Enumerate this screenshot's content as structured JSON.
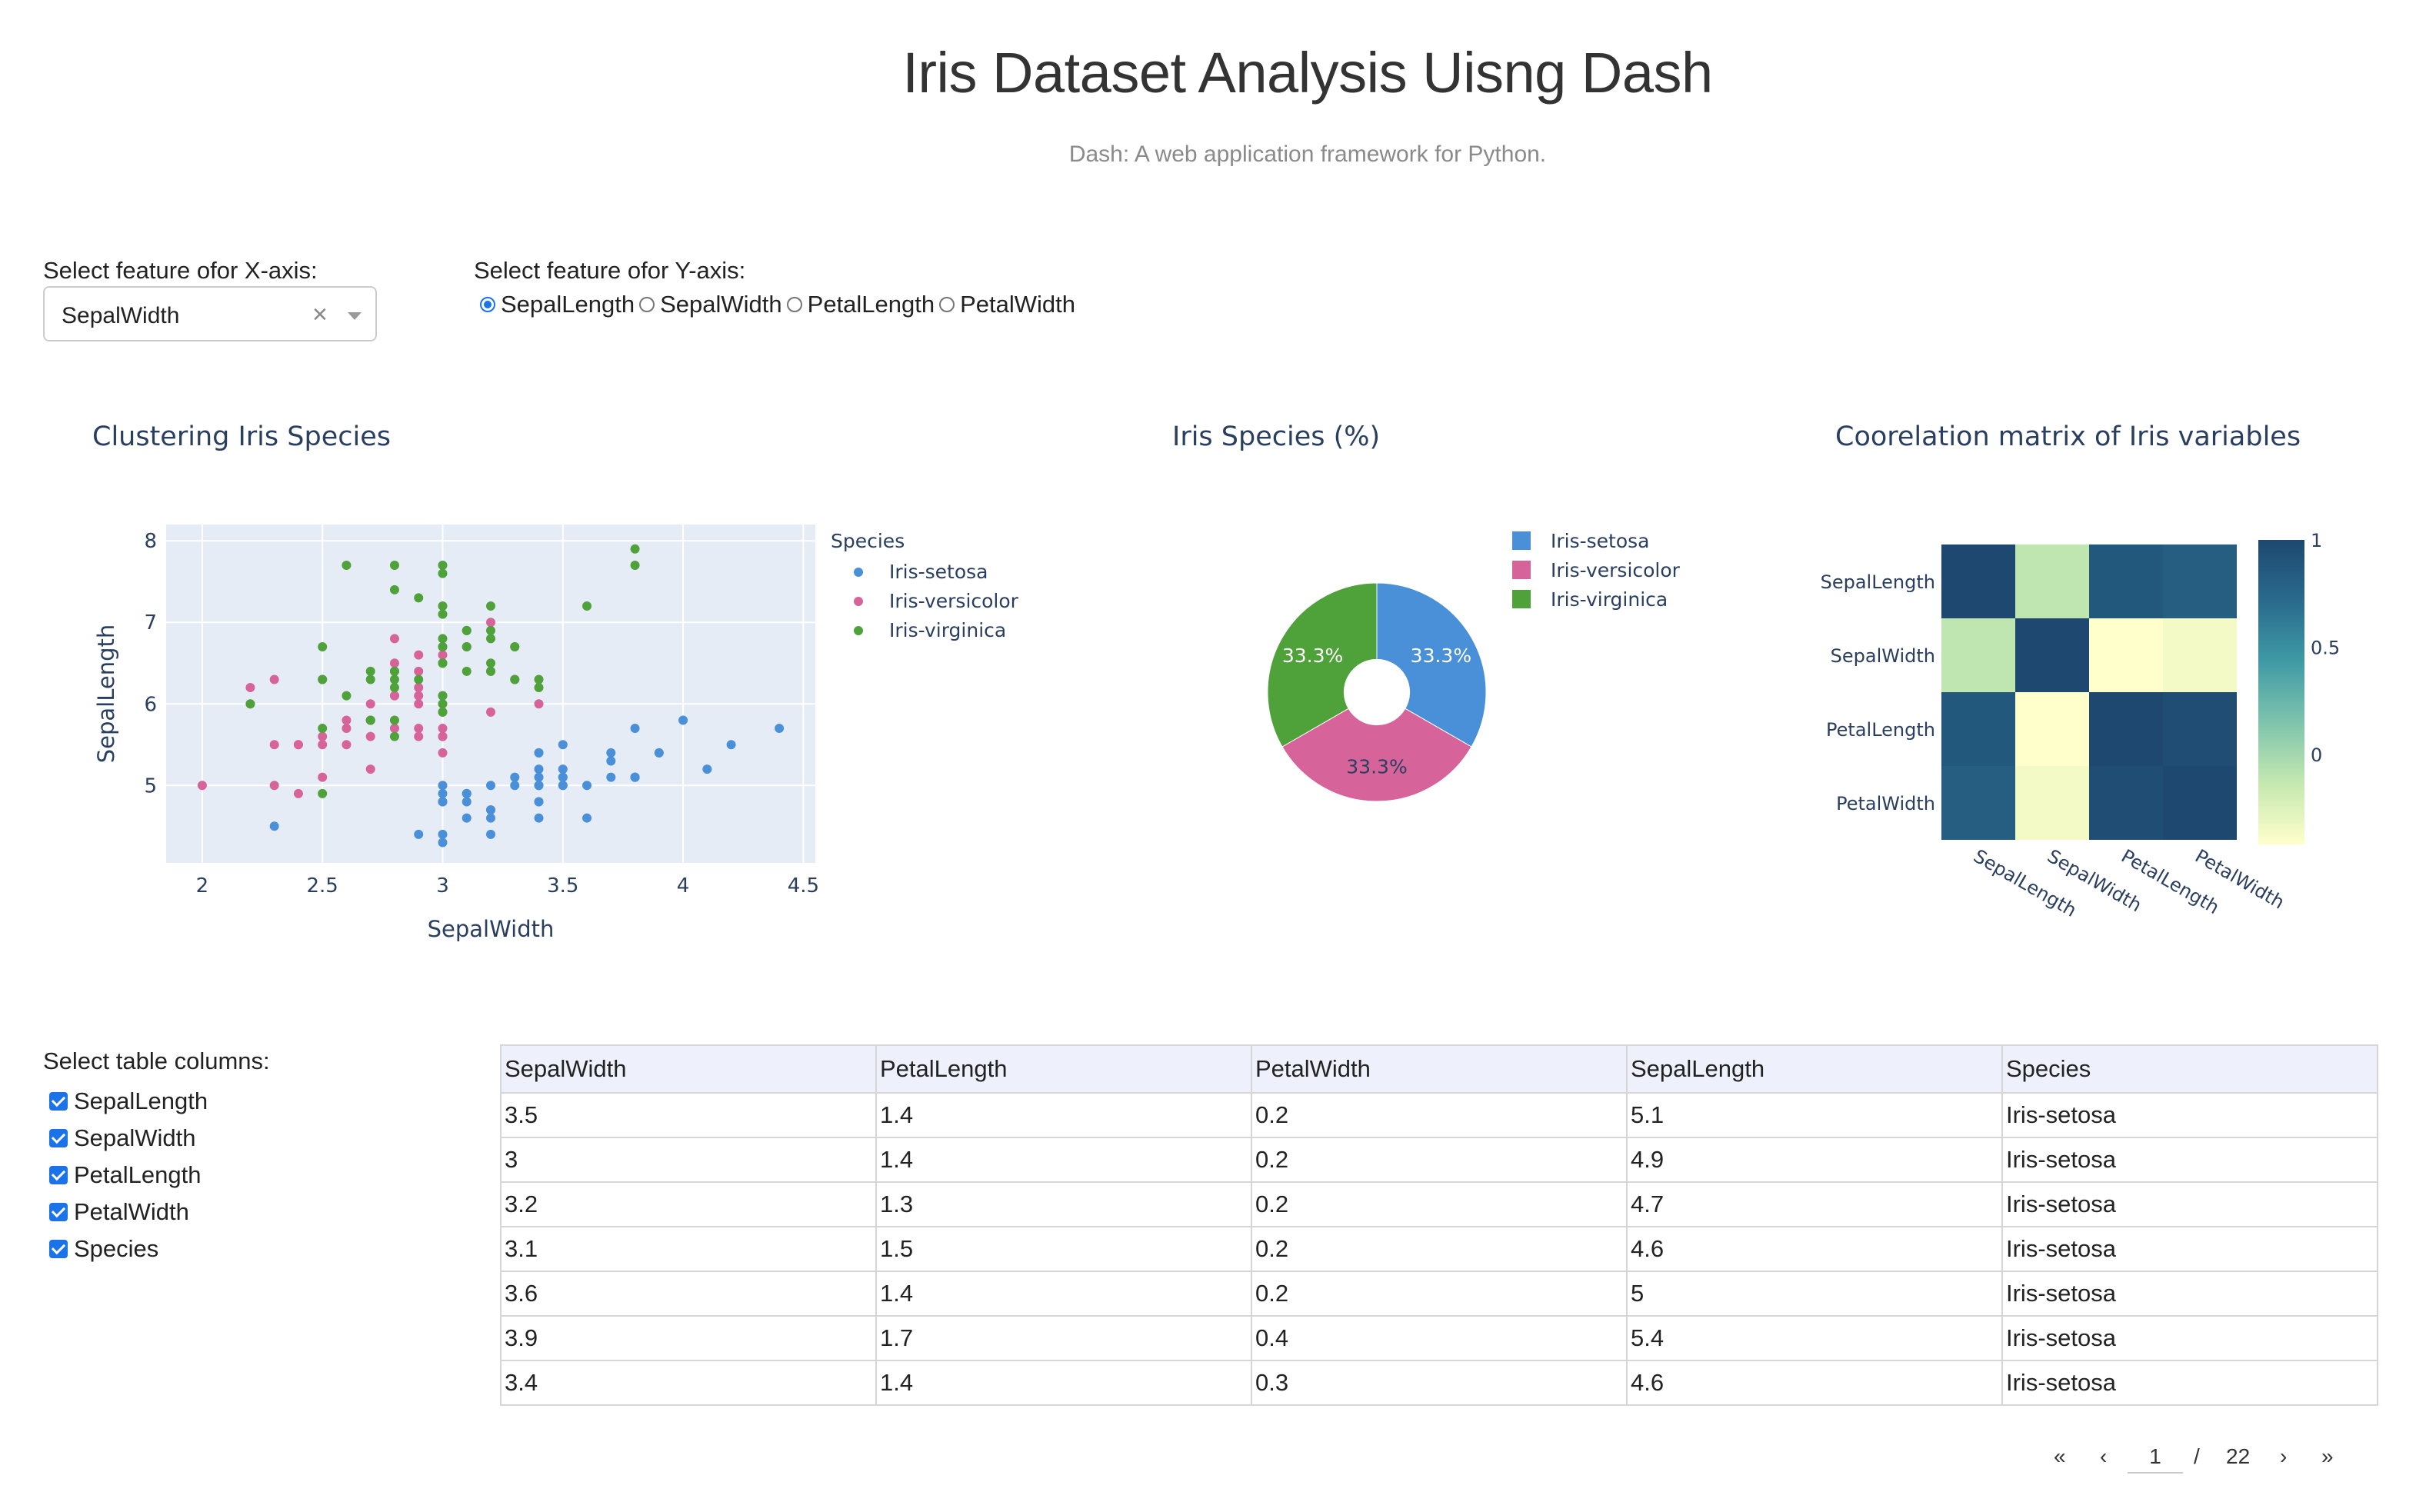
{
  "header": {
    "title": "Iris Dataset Analysis Uisng Dash",
    "subtitle": "Dash: A web application framework for Python."
  },
  "controls": {
    "x_label": "Select feature ofor X-axis:",
    "x_value": "SepalWidth",
    "x_clear_icon": "×",
    "y_label": "Select feature ofor Y-axis:",
    "y_options": [
      "SepalLength",
      "SepalWidth",
      "PetalLength",
      "PetalWidth"
    ],
    "y_selected": "SepalLength",
    "columns_label": "Select table columns:",
    "column_options": [
      "SepalLength",
      "SepalWidth",
      "PetalLength",
      "PetalWidth",
      "Species"
    ]
  },
  "colors": {
    "setosa": "#4a90d9",
    "versicolor": "#d6649b",
    "virginica": "#4fa23a",
    "plot_bg": "#e5ecf6",
    "title": "#2a3f5f",
    "accent": "#1a73e8"
  },
  "chart_data": [
    {
      "type": "scatter",
      "title": "Clustering Iris Species",
      "xlabel": "SepalWidth",
      "ylabel": "SepalLength",
      "xlim": [
        1.85,
        4.55
      ],
      "ylim": [
        4.05,
        8.2
      ],
      "xticks": [
        "2",
        "2.5",
        "3",
        "3.5",
        "4",
        "4.5"
      ],
      "yticks": [
        "5",
        "6",
        "7",
        "8"
      ],
      "legend_title": "Species",
      "legend_position": "right",
      "series": [
        {
          "name": "Iris-setosa",
          "color": "#4a90d9",
          "points": [
            [
              3.5,
              5.1
            ],
            [
              3.0,
              4.9
            ],
            [
              3.2,
              4.7
            ],
            [
              3.1,
              4.6
            ],
            [
              3.6,
              5.0
            ],
            [
              3.9,
              5.4
            ],
            [
              3.4,
              4.6
            ],
            [
              3.4,
              5.0
            ],
            [
              2.9,
              4.4
            ],
            [
              3.1,
              4.9
            ],
            [
              3.7,
              5.4
            ],
            [
              3.4,
              4.8
            ],
            [
              3.0,
              4.8
            ],
            [
              3.0,
              4.3
            ],
            [
              4.0,
              5.8
            ],
            [
              4.4,
              5.7
            ],
            [
              3.9,
              5.4
            ],
            [
              3.5,
              5.1
            ],
            [
              3.8,
              5.7
            ],
            [
              3.8,
              5.1
            ],
            [
              3.4,
              5.4
            ],
            [
              3.7,
              5.1
            ],
            [
              3.6,
              4.6
            ],
            [
              3.3,
              5.1
            ],
            [
              3.4,
              4.8
            ],
            [
              3.0,
              5.0
            ],
            [
              3.4,
              5.0
            ],
            [
              3.5,
              5.2
            ],
            [
              3.4,
              5.2
            ],
            [
              3.2,
              4.7
            ],
            [
              3.1,
              4.8
            ],
            [
              3.4,
              5.4
            ],
            [
              4.1,
              5.2
            ],
            [
              4.2,
              5.5
            ],
            [
              3.1,
              4.9
            ],
            [
              3.2,
              5.0
            ],
            [
              3.5,
              5.5
            ],
            [
              3.1,
              4.9
            ],
            [
              3.0,
              4.4
            ],
            [
              3.4,
              5.1
            ],
            [
              3.5,
              5.0
            ],
            [
              2.3,
              4.5
            ],
            [
              3.2,
              4.4
            ],
            [
              3.5,
              5.0
            ],
            [
              3.8,
              5.1
            ],
            [
              3.0,
              4.8
            ],
            [
              3.8,
              5.1
            ],
            [
              3.2,
              4.6
            ],
            [
              3.7,
              5.3
            ],
            [
              3.3,
              5.0
            ]
          ]
        },
        {
          "name": "Iris-versicolor",
          "color": "#d6649b",
          "points": [
            [
              3.2,
              7.0
            ],
            [
              3.2,
              6.4
            ],
            [
              3.1,
              6.9
            ],
            [
              2.3,
              5.5
            ],
            [
              2.8,
              6.5
            ],
            [
              2.8,
              5.7
            ],
            [
              3.3,
              6.3
            ],
            [
              2.4,
              4.9
            ],
            [
              2.9,
              6.6
            ],
            [
              2.7,
              5.2
            ],
            [
              2.0,
              5.0
            ],
            [
              3.0,
              5.9
            ],
            [
              2.2,
              6.0
            ],
            [
              2.9,
              6.1
            ],
            [
              2.9,
              5.6
            ],
            [
              3.1,
              6.7
            ],
            [
              3.0,
              5.6
            ],
            [
              2.7,
              5.8
            ],
            [
              2.2,
              6.2
            ],
            [
              2.5,
              5.6
            ],
            [
              3.2,
              5.9
            ],
            [
              2.8,
              6.1
            ],
            [
              2.5,
              6.3
            ],
            [
              2.8,
              6.1
            ],
            [
              2.9,
              6.4
            ],
            [
              3.0,
              6.6
            ],
            [
              2.8,
              6.8
            ],
            [
              3.0,
              6.7
            ],
            [
              2.9,
              6.0
            ],
            [
              2.6,
              5.7
            ],
            [
              2.4,
              5.5
            ],
            [
              2.4,
              5.5
            ],
            [
              2.7,
              5.8
            ],
            [
              2.7,
              6.0
            ],
            [
              3.0,
              5.4
            ],
            [
              3.4,
              6.0
            ],
            [
              3.1,
              6.7
            ],
            [
              2.3,
              6.3
            ],
            [
              3.0,
              5.6
            ],
            [
              2.5,
              5.5
            ],
            [
              2.6,
              5.5
            ],
            [
              3.0,
              6.1
            ],
            [
              2.6,
              5.8
            ],
            [
              2.3,
              5.0
            ],
            [
              2.7,
              5.6
            ],
            [
              3.0,
              5.7
            ],
            [
              2.9,
              5.7
            ],
            [
              2.9,
              6.2
            ],
            [
              2.5,
              5.1
            ],
            [
              2.8,
              5.7
            ]
          ]
        },
        {
          "name": "Iris-virginica",
          "color": "#4fa23a",
          "points": [
            [
              3.3,
              6.3
            ],
            [
              2.7,
              5.8
            ],
            [
              3.0,
              7.1
            ],
            [
              2.9,
              6.3
            ],
            [
              3.0,
              6.5
            ],
            [
              3.0,
              7.6
            ],
            [
              2.5,
              4.9
            ],
            [
              2.9,
              7.3
            ],
            [
              2.5,
              6.7
            ],
            [
              3.6,
              7.2
            ],
            [
              3.2,
              6.5
            ],
            [
              2.7,
              6.4
            ],
            [
              3.0,
              6.8
            ],
            [
              2.5,
              5.7
            ],
            [
              2.8,
              5.8
            ],
            [
              3.2,
              6.4
            ],
            [
              3.0,
              6.5
            ],
            [
              3.8,
              7.7
            ],
            [
              2.6,
              7.7
            ],
            [
              2.2,
              6.0
            ],
            [
              3.2,
              6.9
            ],
            [
              2.8,
              5.6
            ],
            [
              2.8,
              7.7
            ],
            [
              2.7,
              6.3
            ],
            [
              3.3,
              6.7
            ],
            [
              3.2,
              7.2
            ],
            [
              2.8,
              6.2
            ],
            [
              3.0,
              6.1
            ],
            [
              2.8,
              6.4
            ],
            [
              3.0,
              7.2
            ],
            [
              2.8,
              7.4
            ],
            [
              3.8,
              7.9
            ],
            [
              2.8,
              6.4
            ],
            [
              2.8,
              6.3
            ],
            [
              2.6,
              6.1
            ],
            [
              3.0,
              7.7
            ],
            [
              3.4,
              6.3
            ],
            [
              3.1,
              6.4
            ],
            [
              3.0,
              6.0
            ],
            [
              3.1,
              6.9
            ],
            [
              3.1,
              6.7
            ],
            [
              3.1,
              6.9
            ],
            [
              2.7,
              5.8
            ],
            [
              3.2,
              6.8
            ],
            [
              3.3,
              6.7
            ],
            [
              3.0,
              6.7
            ],
            [
              2.5,
              6.3
            ],
            [
              3.0,
              6.5
            ],
            [
              3.4,
              6.2
            ],
            [
              3.0,
              5.9
            ]
          ]
        }
      ]
    },
    {
      "type": "pie",
      "title": "Iris Species (%)",
      "hole": 0.3,
      "legend_position": "top-right",
      "labels": [
        "Iris-setosa",
        "Iris-versicolor",
        "Iris-virginica"
      ],
      "values": [
        50,
        50,
        50
      ],
      "texts": [
        "33.3%",
        "33.3%",
        "33.3%"
      ],
      "colors": [
        "#4a90d9",
        "#d6649b",
        "#4fa23a"
      ]
    },
    {
      "type": "heatmap",
      "title": "Coorelation matrix of Iris variables",
      "rows": [
        "SepalLength",
        "SepalWidth",
        "PetalLength",
        "PetalWidth"
      ],
      "cols": [
        "SepalLength",
        "SepalWidth",
        "PetalLength",
        "PetalWidth"
      ],
      "values": [
        [
          1.0,
          -0.11,
          0.87,
          0.82
        ],
        [
          -0.11,
          1.0,
          -0.42,
          -0.36
        ],
        [
          0.87,
          -0.42,
          1.0,
          0.96
        ],
        [
          0.82,
          -0.36,
          0.96,
          1.0
        ]
      ],
      "colorbar_ticks": [
        "1",
        "0.5",
        "0"
      ],
      "zrange": [
        -0.42,
        1.0
      ],
      "colorscale": [
        "#ffffcc",
        "#c5e8b0",
        "#7fc4ad",
        "#3f9aa5",
        "#2a6a8c",
        "#1e4870"
      ]
    }
  ],
  "table": {
    "columns": [
      "SepalWidth",
      "PetalLength",
      "PetalWidth",
      "SepalLength",
      "Species"
    ],
    "rows": [
      [
        "3.5",
        "1.4",
        "0.2",
        "5.1",
        "Iris-setosa"
      ],
      [
        "3",
        "1.4",
        "0.2",
        "4.9",
        "Iris-setosa"
      ],
      [
        "3.2",
        "1.3",
        "0.2",
        "4.7",
        "Iris-setosa"
      ],
      [
        "3.1",
        "1.5",
        "0.2",
        "4.6",
        "Iris-setosa"
      ],
      [
        "3.6",
        "1.4",
        "0.2",
        "5",
        "Iris-setosa"
      ],
      [
        "3.9",
        "1.7",
        "0.4",
        "5.4",
        "Iris-setosa"
      ],
      [
        "3.4",
        "1.4",
        "0.3",
        "4.6",
        "Iris-setosa"
      ]
    ]
  },
  "pagination": {
    "first": "«",
    "prev": "‹",
    "current": "1",
    "separator": "/",
    "total": "22",
    "next": "›",
    "last": "»"
  }
}
